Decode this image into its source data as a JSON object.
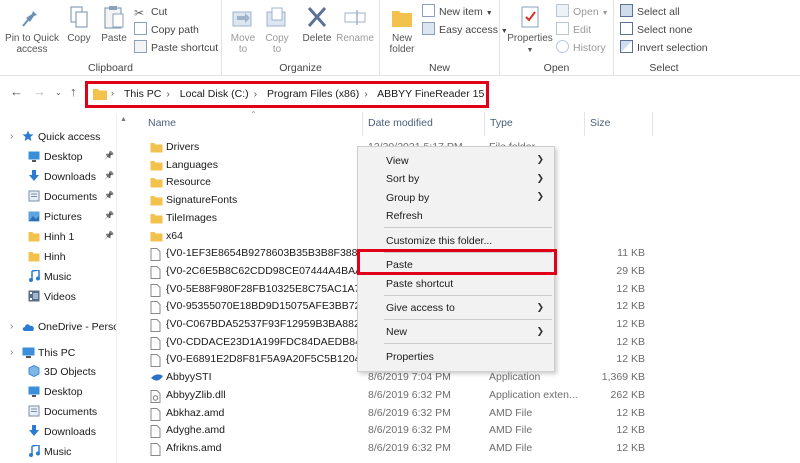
{
  "ribbon": {
    "clipboard": {
      "label": "Clipboard",
      "pin_to_quick_access": [
        "Pin to Quick",
        "access"
      ],
      "copy": "Copy",
      "paste": "Paste",
      "cut": "Cut",
      "copy_path": "Copy path",
      "paste_shortcut": "Paste shortcut"
    },
    "organize": {
      "label": "Organize",
      "move_to": [
        "Move",
        "to"
      ],
      "copy_to": [
        "Copy",
        "to"
      ],
      "delete": "Delete",
      "rename": "Rename"
    },
    "new": {
      "label": "New",
      "new_folder": [
        "New",
        "folder"
      ],
      "new_item": "New item",
      "easy_access": "Easy access"
    },
    "open": {
      "label": "Open",
      "properties": "Properties",
      "open": "Open",
      "edit": "Edit",
      "history": "History"
    },
    "select": {
      "label": "Select",
      "select_all": "Select all",
      "select_none": "Select none",
      "invert_selection": "Invert selection"
    }
  },
  "address": {
    "crumbs": [
      "This PC",
      "Local Disk (C:)",
      "Program Files (x86)",
      "ABBYY FineReader 15"
    ]
  },
  "columns": {
    "name": "Name",
    "date": "Date modified",
    "type": "Type",
    "size": "Size"
  },
  "nav": [
    {
      "label": "Quick access",
      "icon": "star-icon",
      "pinned": false
    },
    {
      "label": "Desktop",
      "icon": "desktop-icon",
      "pinned": true
    },
    {
      "label": "Downloads",
      "icon": "download-icon",
      "pinned": true
    },
    {
      "label": "Documents",
      "icon": "documents-icon",
      "pinned": true
    },
    {
      "label": "Pictures",
      "icon": "pictures-icon",
      "pinned": true
    },
    {
      "label": "Hinh 1",
      "icon": "folder-icon",
      "pinned": true
    },
    {
      "label": "Hinh",
      "icon": "folder-icon",
      "pinned": false
    },
    {
      "label": "Music",
      "icon": "music-icon",
      "pinned": false
    },
    {
      "label": "Videos",
      "icon": "videos-icon",
      "pinned": false
    },
    {
      "label": "OneDrive - Persor",
      "icon": "cloud-icon",
      "pinned": false
    },
    {
      "label": "This PC",
      "icon": "pc-icon",
      "pinned": false
    },
    {
      "label": "3D Objects",
      "icon": "cube-icon",
      "pinned": false
    },
    {
      "label": "Desktop",
      "icon": "desktop-icon",
      "pinned": false
    },
    {
      "label": "Documents",
      "icon": "documents-icon",
      "pinned": false
    },
    {
      "label": "Downloads",
      "icon": "download-icon",
      "pinned": false
    },
    {
      "label": "Music",
      "icon": "music-icon",
      "pinned": false
    }
  ],
  "files": [
    {
      "name": "Drivers",
      "kind": "folder",
      "date": "12/30/2021 5:17 PM",
      "type": "File folder",
      "size": ""
    },
    {
      "name": "Languages",
      "kind": "folder",
      "date": "",
      "type": "",
      "size": ""
    },
    {
      "name": "Resource",
      "kind": "folder",
      "date": "",
      "type": "",
      "size": ""
    },
    {
      "name": "SignatureFonts",
      "kind": "folder",
      "date": "",
      "type": "",
      "size": ""
    },
    {
      "name": "TileImages",
      "kind": "folder",
      "date": "",
      "type": "",
      "size": ""
    },
    {
      "name": "x64",
      "kind": "folder",
      "date": "",
      "type": "",
      "size": ""
    },
    {
      "name": "{V0-1EF3E8654B9278603B35B3B8F38817C...",
      "kind": "file",
      "date": "",
      "type": "",
      "size": "11 KB"
    },
    {
      "name": "{V0-2C6E5B8C62CDD98CE07444A4BAA6...",
      "kind": "file",
      "date": "",
      "type": "",
      "size": "29 KB"
    },
    {
      "name": "{V0-5E88F980F28FB10325E8C75AC1A7D5...",
      "kind": "file",
      "date": "",
      "type": "",
      "size": "12 KB"
    },
    {
      "name": "{V0-95355070E18BD9D15075AFE3BB72914...",
      "kind": "file",
      "date": "",
      "type": "",
      "size": "12 KB"
    },
    {
      "name": "{V0-C067BDA52537F93F12959B3BA88281...",
      "kind": "file",
      "date": "",
      "type": "",
      "size": "12 KB"
    },
    {
      "name": "{V0-CDDACE23D1A199FDC84DAEDB84C...",
      "kind": "file",
      "date": "",
      "type": "",
      "size": "12 KB"
    },
    {
      "name": "{V0-E6891E2D8F81F5A9A20F5C5B120407...",
      "kind": "file",
      "date": "",
      "type": "",
      "size": "12 KB"
    },
    {
      "name": "AbbyySTI",
      "kind": "app",
      "date": "8/6/2019 7:04 PM",
      "type": "Application",
      "size": "1,369 KB"
    },
    {
      "name": "AbbyyZlib.dll",
      "kind": "dll",
      "date": "8/6/2019 6:32 PM",
      "type": "Application exten...",
      "size": "262 KB"
    },
    {
      "name": "Abkhaz.amd",
      "kind": "file",
      "date": "8/6/2019 6:32 PM",
      "type": "AMD File",
      "size": "12 KB"
    },
    {
      "name": "Adyghe.amd",
      "kind": "file",
      "date": "8/6/2019 6:32 PM",
      "type": "AMD File",
      "size": "12 KB"
    },
    {
      "name": "Afrikns.amd",
      "kind": "file",
      "date": "8/6/2019 6:32 PM",
      "type": "AMD File",
      "size": "12 KB"
    }
  ],
  "context_menu": {
    "view": "View",
    "sort_by": "Sort by",
    "group_by": "Group by",
    "refresh": "Refresh",
    "customize": "Customize this folder...",
    "paste": "Paste",
    "paste_shortcut": "Paste shortcut",
    "give_access": "Give access to",
    "new": "New",
    "properties": "Properties"
  },
  "colors": {
    "highlight": "#e0001a",
    "folder": "#f3c24c",
    "accent": "#1e73c8"
  }
}
